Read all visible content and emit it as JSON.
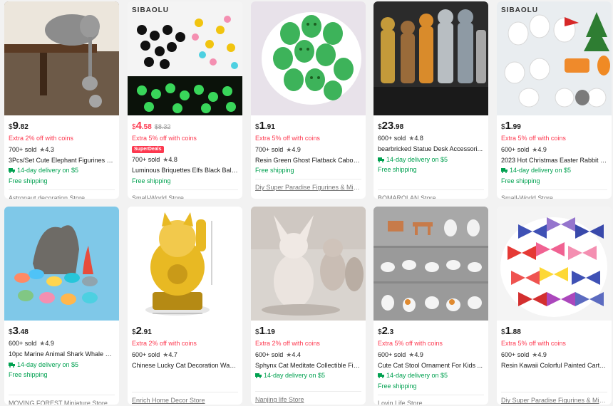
{
  "products": [
    {
      "thumb_text": "",
      "price_currency": "$",
      "price_int": "9",
      "price_dec": ".82",
      "price_red": false,
      "old_price": "",
      "promo": "Extra 2% off with coins",
      "badge": "",
      "sold": "700+ sold",
      "rating": "4.3",
      "title": "3Pcs/Set Cute Elephant Figurines El...",
      "delivery": "14-day delivery on $5",
      "shipping": "Free shipping",
      "store": "Astronaut decoration Store"
    },
    {
      "thumb_text": "SIBAOLU",
      "price_currency": "$",
      "price_int": "4",
      "price_dec": ".58",
      "price_red": true,
      "old_price": "$8.32",
      "promo": "Extra 5% off with coins",
      "badge": "SuperDeals",
      "sold": "700+ sold",
      "rating": "4.8",
      "title": "Luminous Briquettes Elfs Black Ball...",
      "delivery": "",
      "shipping": "Free shipping",
      "store": "Small-World Store"
    },
    {
      "thumb_text": "",
      "price_currency": "$",
      "price_int": "1",
      "price_dec": ".91",
      "price_red": false,
      "old_price": "",
      "promo": "Extra 5% off with coins",
      "badge": "",
      "sold": "700+ sold",
      "rating": "4.9",
      "title": "Resin Green Ghost Flatback Caboc...",
      "delivery": "",
      "shipping": "Free shipping",
      "store": "Diy Super Paradise Figurines & Min..."
    },
    {
      "thumb_text": "",
      "price_currency": "$",
      "price_int": "23",
      "price_dec": ".98",
      "price_red": false,
      "old_price": "",
      "promo": "",
      "badge": "",
      "sold": "600+ sold",
      "rating": "4.8",
      "title": "bearbricked Statue Desk Accessori...",
      "delivery": "14-day delivery on $5",
      "shipping": "Free shipping",
      "store": "BOMAROLAN Store"
    },
    {
      "thumb_text": "SIBAOLU",
      "price_currency": "$",
      "price_int": "1",
      "price_dec": ".99",
      "price_red": false,
      "old_price": "",
      "promo": "Extra 5% off with coins",
      "badge": "",
      "sold": "600+ sold",
      "rating": "4.9",
      "title": "2023 Hot Christmas Easter Rabbit F...",
      "delivery": "14-day delivery on $5",
      "shipping": "Free shipping",
      "store": "Small-World Store"
    },
    {
      "thumb_text": "",
      "price_currency": "$",
      "price_int": "3",
      "price_dec": ".48",
      "price_red": false,
      "old_price": "",
      "promo": "",
      "badge": "",
      "sold": "600+ sold",
      "rating": "4.9",
      "title": "10pc Marine Animal Shark Whale S...",
      "delivery": "14-day delivery on $5",
      "shipping": "Free shipping",
      "store": "MOVING FOREST Miniature Store"
    },
    {
      "thumb_text": "",
      "price_currency": "$",
      "price_int": "2",
      "price_dec": ".91",
      "price_red": false,
      "old_price": "",
      "promo": "Extra 2% off with coins",
      "badge": "",
      "sold": "600+ sold",
      "rating": "4.7",
      "title": "Chinese Lucky Cat Decoration Wavi...",
      "delivery": "",
      "shipping": "",
      "store": "Enrich Home Decor Store"
    },
    {
      "thumb_text": "",
      "price_currency": "$",
      "price_int": "1",
      "price_dec": ".19",
      "price_red": false,
      "old_price": "",
      "promo": "Extra 2% off with coins",
      "badge": "",
      "sold": "600+ sold",
      "rating": "4.4",
      "title": "Sphynx Cat Meditate Collectible Fig...",
      "delivery": "14-day delivery on $5",
      "shipping": "",
      "store": "Nanjing life Store"
    },
    {
      "thumb_text": "",
      "price_currency": "$",
      "price_int": "2",
      "price_dec": ".3",
      "price_red": false,
      "old_price": "",
      "promo": "Extra 5% off with coins",
      "badge": "",
      "sold": "600+ sold",
      "rating": "4.9",
      "title": "Cute Cat Stool Ornament For Kids ...",
      "delivery": "14-day delivery on $5",
      "shipping": "Free shipping",
      "store": "Lovin Life Store"
    },
    {
      "thumb_text": "",
      "price_currency": "$",
      "price_int": "1",
      "price_dec": ".88",
      "price_red": false,
      "old_price": "",
      "promo": "Extra 5% off with coins",
      "badge": "",
      "sold": "600+ sold",
      "rating": "4.9",
      "title": "Resin Kawaii Colorful Painted Carto...",
      "delivery": "",
      "shipping": "",
      "store": "Diy Super Paradise Figurines & Min..."
    }
  ],
  "colors": {
    "promo_red": "#fd384f",
    "shipping_green": "#00a150",
    "page_bg": "#f2f2f2"
  }
}
